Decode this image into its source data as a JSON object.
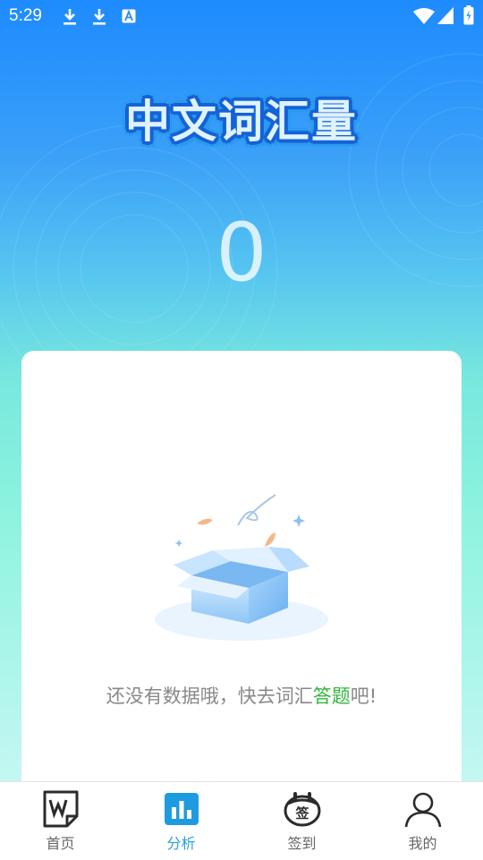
{
  "status_bar": {
    "time": "5:29"
  },
  "app": {
    "title": "中文词汇量"
  },
  "score": {
    "value": "0"
  },
  "empty_state": {
    "message_prefix": "还没有数据哦，快去词汇",
    "message_link": "答题",
    "message_suffix": "吧!"
  },
  "tab_bar": {
    "tabs": [
      {
        "label": "首页",
        "icon": "word-document-icon",
        "active": false
      },
      {
        "label": "分析",
        "icon": "bar-chart-icon",
        "active": true
      },
      {
        "label": "签到",
        "icon": "sign-in-calendar-icon",
        "active": false
      },
      {
        "label": "我的",
        "icon": "user-profile-icon",
        "active": false
      }
    ]
  },
  "colors": {
    "accent": "#2a9fe0",
    "link_green": "#30b63a",
    "background_top": "#1e8bff",
    "background_bottom": "#d6f8f6"
  }
}
